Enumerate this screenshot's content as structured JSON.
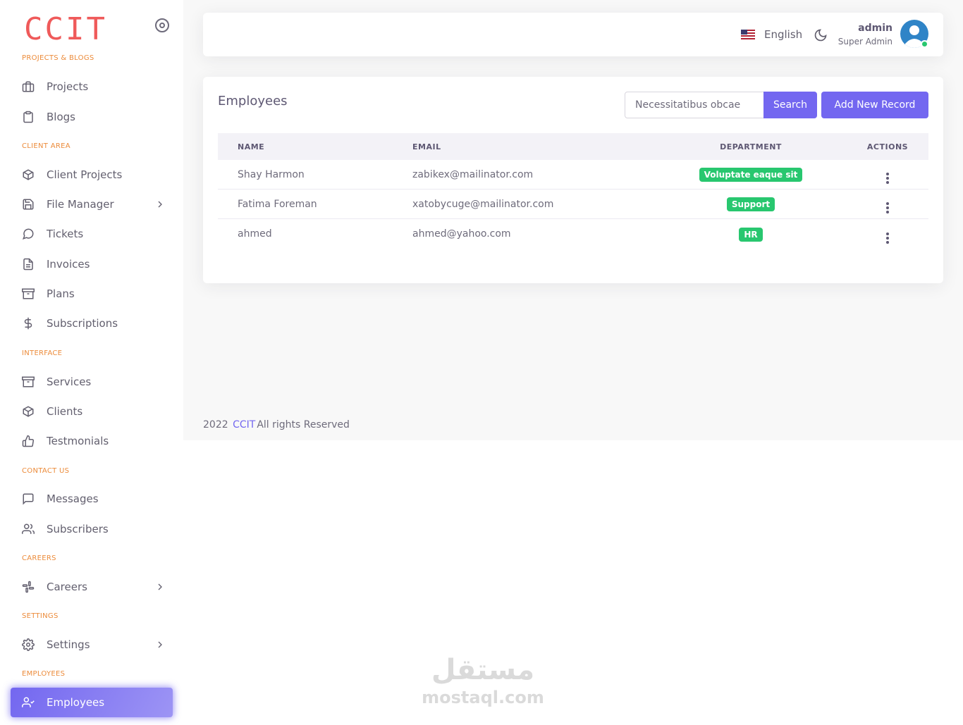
{
  "brand": {
    "logo": "CCIT"
  },
  "sidebar": {
    "sections": {
      "projects_blogs": "PROJECTS & BLOGS",
      "client_area": "CLIENT AREA",
      "interface": "INTERFACE",
      "contact_us": "CONTACT US",
      "careers": "CAREERS",
      "settings": "SETTINGS",
      "employees": "EMPLOYEES"
    },
    "items": {
      "projects": "Projects",
      "blogs": "Blogs",
      "client_projects": "Client Projects",
      "file_manager": "File Manager",
      "tickets": "Tickets",
      "invoices": "Invoices",
      "plans": "Plans",
      "subscriptions": "Subscriptions",
      "services": "Services",
      "clients": "Clients",
      "testimonials": "Testmonials",
      "messages": "Messages",
      "subscribers": "Subscribers",
      "careers": "Careers",
      "settings": "Settings",
      "employees": "Employees"
    }
  },
  "navbar": {
    "language": "English",
    "user_name": "admin",
    "user_role": "Super Admin"
  },
  "main": {
    "title": "Employees",
    "search": {
      "value": "Necessitatibus obcae",
      "button": "Search"
    },
    "add_button": "Add New Record",
    "table": {
      "headers": {
        "name": "NAME",
        "email": "EMAIL",
        "department": "DEPARTMENT",
        "actions": "ACTIONS"
      },
      "rows": [
        {
          "name": "Shay Harmon",
          "email": "zabikex@mailinator.com",
          "department": "Voluptate eaque sit"
        },
        {
          "name": "Fatima Foreman",
          "email": "xatobycuge@mailinator.com",
          "department": "Support"
        },
        {
          "name": "ahmed",
          "email": "ahmed@yahoo.com",
          "department": "HR"
        }
      ]
    }
  },
  "footer": {
    "year": "2022",
    "brand": "CCIT",
    "text": "All rights Reserved"
  },
  "watermark": {
    "arabic": "مستقل",
    "latin": "mostaql.com"
  },
  "colors": {
    "accent": "#7367f0",
    "badge": "#28c76f",
    "logo": "#ef5a5a",
    "section": "#ec8b3a"
  }
}
